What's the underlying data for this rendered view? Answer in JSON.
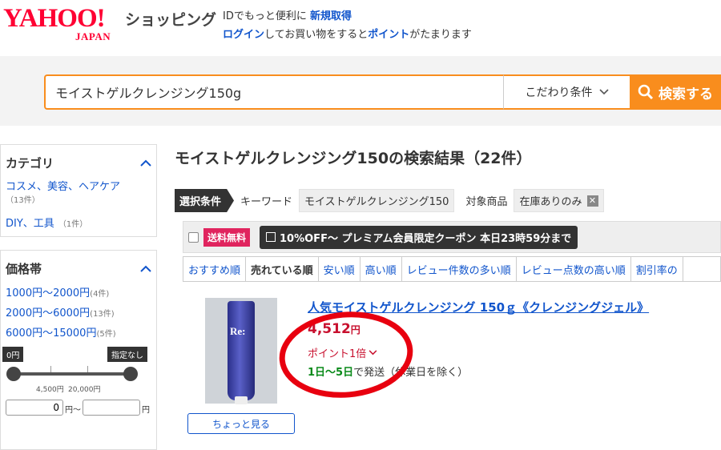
{
  "header": {
    "logo_main": "YAHOO!",
    "logo_sub": "JAPAN",
    "shop_title": "ショッピング",
    "line1_prefix": "IDでもっと便利に",
    "line1_link": "新規取得",
    "line2_login": "ログイン",
    "line2_middle": "してお買い物をすると",
    "line2_point": "ポイント",
    "line2_suffix": "がたまります"
  },
  "search": {
    "query": "モイストゲルクレンジング150g",
    "conditions_label": "こだわり条件",
    "button_label": "検索する"
  },
  "sidebar": {
    "category_title": "カテゴリ",
    "categories": [
      {
        "label": "コスメ、美容、ヘアケア",
        "count": "（13件）"
      },
      {
        "label": "DIY、工具",
        "count": "（1件）"
      }
    ],
    "price_title": "価格帯",
    "prices": [
      {
        "label": "1000円〜2000円",
        "count": "(4件)"
      },
      {
        "label": "2000円〜6000円",
        "count": "(13件)"
      },
      {
        "label": "6000円〜15000円",
        "count": "(5件)"
      }
    ],
    "slider_min": "0円",
    "slider_max": "指定なし",
    "tick_left": "4,500円",
    "tick_right": "20,000円",
    "min_value": "0",
    "yen_sep": "円〜",
    "yen_end": "円"
  },
  "results": {
    "title": "モイストゲルクレンジング150の検索結果（22件）",
    "selected_label": "選択条件",
    "keyword_label": "キーワード",
    "keyword_value": "モイストゲルクレンジング150",
    "target_label": "対象商品",
    "target_value": "在庫ありのみ",
    "free_shipping": "送料無料",
    "coupon": "10%OFF〜 プレミアム会員限定クーポン 本日23時59分まで",
    "sort_tabs": [
      "おすすめ順",
      "売れている順",
      "安い順",
      "高い順",
      "レビュー件数の多い順",
      "レビュー点数の高い順",
      "割引率の"
    ],
    "active_sort": 1
  },
  "product": {
    "title": "人気モイストゲルクレンジング 150ｇ《クレンジングジェル》",
    "price": "4,512",
    "price_unit": "円",
    "points": "ポイント1倍",
    "shipping_days": "1日〜5日",
    "shipping_suffix": "で発送（休業日を除く）",
    "quick_view": "ちょっと見る",
    "tube_label": "Re:"
  },
  "colors": {
    "accent": "#f98d1d",
    "brand": "#ff0033",
    "link": "#1155cc",
    "price": "#c8102e",
    "green": "#0a8a1a",
    "annotation": "#e8000f"
  }
}
